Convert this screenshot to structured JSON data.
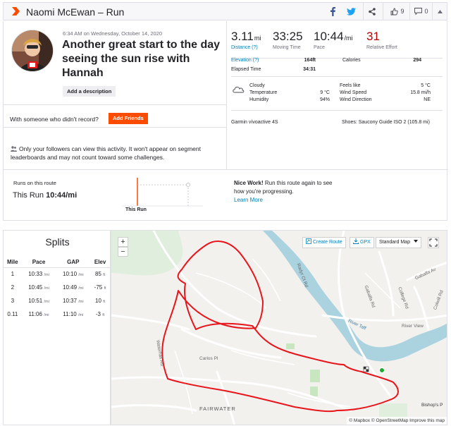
{
  "header": {
    "title": "Naomi McEwan – Run",
    "kudos_count": "9",
    "comment_count": "0"
  },
  "activity": {
    "date": "6:34 AM on Wednesday, October 14, 2020",
    "title": "Another great start to the day seeing the sun rise with Hannah",
    "add_description": "Add a description",
    "someone_prompt": "With someone who didn't record?",
    "add_friends": "Add Friends",
    "privacy_note": "Only your followers can view this activity. It won't appear on segment leaderboards and may not count toward some challenges."
  },
  "stats": {
    "distance_value": "3.11",
    "distance_unit": "mi",
    "distance_label": "Distance (?)",
    "moving_time_value": "33:25",
    "moving_time_label": "Moving Time",
    "pace_value": "10:44",
    "pace_unit": "/mi",
    "pace_label": "Pace",
    "relative_effort_value": "31",
    "relative_effort_label": "Relative Effort"
  },
  "details": {
    "elevation_label": "Elevation (?)",
    "elevation_value": "164ft",
    "calories_label": "Calories",
    "calories_value": "294",
    "elapsed_label": "Elapsed Time",
    "elapsed_value": "34:31"
  },
  "weather": {
    "condition": "Cloudy",
    "temperature_label": "Temperature",
    "temperature_value": "9 °C",
    "humidity_label": "Humidity",
    "humidity_value": "94%",
    "feels_like_label": "Feels like",
    "feels_like_value": "5 °C",
    "wind_speed_label": "Wind Speed",
    "wind_speed_value": "15.8 mi/h",
    "wind_direction_label": "Wind Direction",
    "wind_direction_value": "NE"
  },
  "gear": {
    "device": "Garmin vívoactive 4S",
    "shoes": "Shoes: Saucony Guide ISO 2 (105.8 mi)"
  },
  "route_compare": {
    "label": "Runs on this route",
    "this_run_prefix": "This Run",
    "this_run_pace": "10:44/mi",
    "chart_label": "This Run",
    "nice_bold": "Nice Work!",
    "nice_text": "Run this route again to see how you're progressing.",
    "learn_more": "Learn More"
  },
  "splits": {
    "title": "Splits",
    "headers": [
      "Mile",
      "Pace",
      "GAP",
      "Elev"
    ],
    "rows": [
      {
        "mile": "1",
        "pace": "10:33",
        "gap": "10:10",
        "elev": "85",
        "elev_unit": "ft"
      },
      {
        "mile": "2",
        "pace": "10:45",
        "gap": "10:49",
        "elev": "-75",
        "elev_unit": "ft"
      },
      {
        "mile": "3",
        "pace": "10:51",
        "gap": "10:37",
        "elev": "10",
        "elev_unit": "ft"
      },
      {
        "mile": "0.11",
        "pace": "11:06",
        "gap": "11:10",
        "elev": "-3",
        "elev_unit": "ft"
      }
    ],
    "pace_unit": "/mi"
  },
  "map": {
    "zoom_in": "+",
    "zoom_out": "−",
    "create_route": "Create Route",
    "gpx": "GPX",
    "map_style": "Standard Map",
    "attribution": "© Mapbox © OpenStreetMap Improve this map",
    "labels": {
      "fairwater": "FAIRWATER",
      "river_taff": "River Taff",
      "bishops_park": "Bishop's P",
      "carlos_pl": "Carlos Pl",
      "river_view": "River View",
      "gabalfa": "Gabalfa Av",
      "gabalfa_rd": "Gabalfa Rd",
      "college_rd": "College Rd",
      "radyr_ct_rd": "Radyr Ct Rd",
      "colwill_rd": "Colwill Rd",
      "waterhall": "Waterhall Rd"
    }
  },
  "colors": {
    "brand": "#fc4c02",
    "route": "#e8151b",
    "link": "#007fb6",
    "relative_effort": "#c00000",
    "river": "#aad3df",
    "park": "#c8e6c0"
  }
}
